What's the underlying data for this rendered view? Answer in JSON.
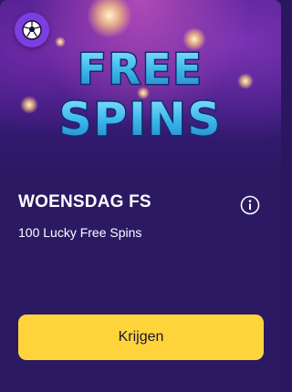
{
  "promo": {
    "banner_text_line1": "FREE",
    "banner_text_line2": "SPINS",
    "badge_icon": "soccer-ball-icon",
    "title": "WOENSDAG FS",
    "info_icon": "info-icon",
    "description": "100 Lucky Free Spins",
    "cta_label": "Krijgen"
  },
  "colors": {
    "card_background": "#2b1a63",
    "badge": "#7b3fe0",
    "cta_background": "#ffd43b",
    "banner_text": "#43c7f0"
  }
}
